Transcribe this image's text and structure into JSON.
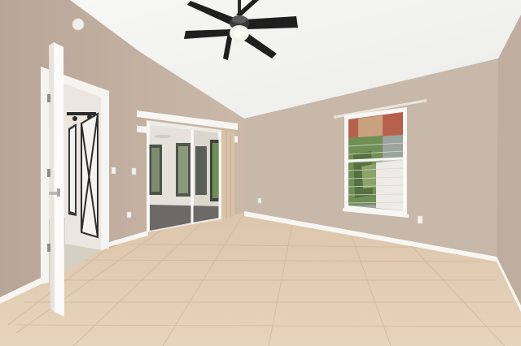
{
  "scene": {
    "kind": "interior-photo",
    "room": "empty bedroom",
    "features": [
      "vaulted-ceiling",
      "ceiling-fan",
      "sliding-glass-door",
      "barn-door",
      "window-with-blinds",
      "tile-floor",
      "open-door"
    ]
  },
  "colors": {
    "ceiling": "#f4f4f2",
    "wall_left": "#c2afa1",
    "wall_back": "#c8b8a9",
    "wall_right": "#bfae9f",
    "floor": "#e2cdb3",
    "floor_grout": "#cdb69a",
    "trim": "#f7f6f3",
    "fan_blades": "#1f1f1f",
    "fan_light": "#ffffff",
    "outdoor_foliage": "#6f8f55",
    "blinds_red": "#b7614d"
  }
}
